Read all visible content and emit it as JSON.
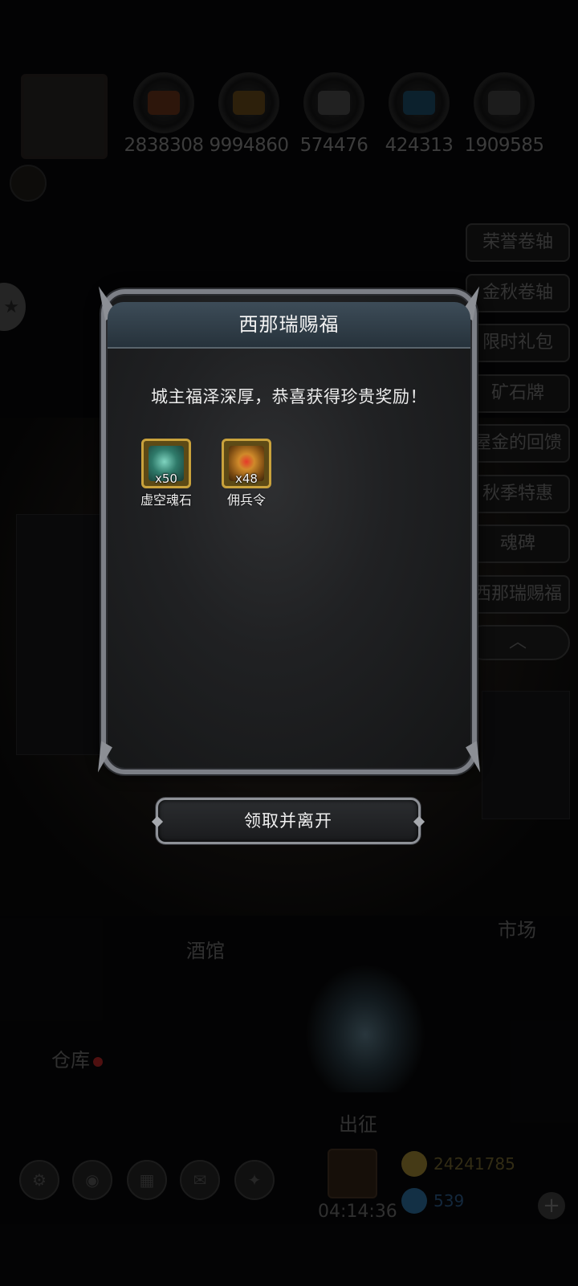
{
  "top_resources": [
    {
      "icon": "ore-icon",
      "value": "2838308",
      "color": "#b05a2a"
    },
    {
      "icon": "wood-plank-icon",
      "value": "9994860",
      "color": "#b0782a"
    },
    {
      "icon": "stone-block-icon",
      "value": "574476",
      "color": "#8a8a8a"
    },
    {
      "icon": "crystal-icon",
      "value": "424313",
      "color": "#3a8ab0"
    },
    {
      "icon": "iron-ingot-icon",
      "value": "1909585",
      "color": "#7a7a7a"
    }
  ],
  "side_menu": {
    "items": [
      "荣誉卷轴",
      "金秋卷轴",
      "限时礼包",
      "矿石牌",
      "屋金的回馈",
      "秋季特惠",
      "魂碑",
      "西那瑞赐福"
    ],
    "collapse_icon": "chevron-up-icon"
  },
  "map_labels": {
    "tavern": "酒馆",
    "market": "市场",
    "warehouse": "仓库",
    "expedition": "出征"
  },
  "bottom": {
    "timer": "04:14:36",
    "gold": "24241785",
    "gems": "539",
    "gold_color": "#6a5a22",
    "gem_color": "#1e4a6a"
  },
  "dialog": {
    "title": "西那瑞赐福",
    "message": "城主福泽深厚，恭喜获得珍贵奖励！",
    "rewards": [
      {
        "name": "虚空魂石",
        "qty": "x50",
        "icon": "void-soul-stone-icon",
        "art_color": "#2f7a6a"
      },
      {
        "name": "佣兵令",
        "qty": "x48",
        "icon": "mercenary-token-icon",
        "art_color": "#b06a1a"
      }
    ],
    "claim_label": "领取并离开"
  }
}
